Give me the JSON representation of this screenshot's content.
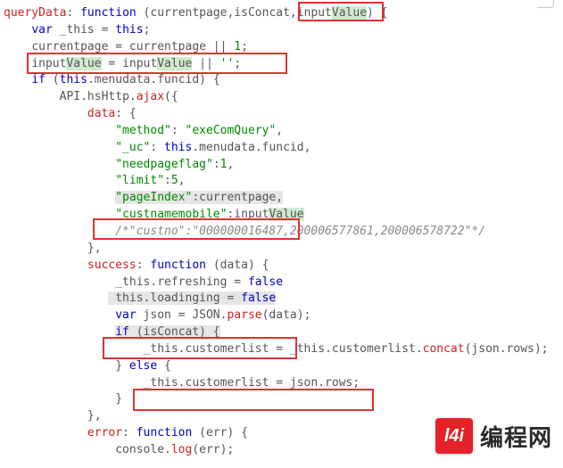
{
  "code": {
    "fn_decl_pre": "queryData",
    "fn_decl_mid": ": ",
    "fn_kw": "function",
    "fn_params_open": " (currentpage,isConcat,input",
    "fn_param_sel": "Value",
    "fn_params_close": ") {",
    "l2a": "var",
    "l2b": " _this = ",
    "l2c": "this",
    "l2d": ";",
    "l3": "currentpage = currentpage || ",
    "l3n": "1",
    "l3e": ";",
    "l4a": "input",
    "l4sel": "Value",
    "l4b": " = input",
    "l4sel2": "Value",
    "l4c": " || ",
    "l4d": "''",
    "l4e": ";",
    "l5a": "if",
    "l5b": " (",
    "l5c": "this",
    "l5d": ".menudata.funcid) {",
    "l6a": "API.hsHttp.",
    "l6b": "ajax",
    "l6c": "({",
    "l7a": "data",
    "l7b": ": {",
    "l8k": "\"method\"",
    "l8v": "\"exeComQuery\"",
    "l9k": "\"_uc\"",
    "l9a": "this",
    "l9b": ".menudata.funcid,",
    "l10k": "\"needpageflag\"",
    "l10v": "1",
    "l11k": "\"limit\"",
    "l11v": "5",
    "l12k": "\"pageIndex\"",
    "l12v": ":currentpage,",
    "l13k": "\"custnamemobile\"",
    "l13a": ":input",
    "l13sel": "Value",
    "l14": "/*\"custno\":\"000000016487,200006577861,200006578722\"*/",
    "l15": "},",
    "l16a": "success",
    "l16b": "function",
    "l16c": " (data) {",
    "l17a": "_this.refreshing = ",
    "l17b": "false",
    "l18a": " this.loadinging = ",
    "l18b": "false",
    "l19a": "var",
    "l19b": " json = JSON.",
    "l19c": "parse",
    "l19d": "(data);",
    "l20a": "if",
    "l20b": " (isConcat) {",
    "l21": "_this.customerlist = _this.customerlist.",
    "l21b": "concat",
    "l21c": "(json.rows);",
    "l22a": "} ",
    "l22b": "else",
    "l22c": " {",
    "l23": "_this.customerlist = json.rows;",
    "l24": "}",
    "l25": "},",
    "l26a": "error",
    "l26b": "function",
    "l26c": " (err) {",
    "l27a": "console.",
    "l27b": "log",
    "l27c": "(err);"
  },
  "logo": {
    "badge": "l4i",
    "text": "编程网"
  }
}
